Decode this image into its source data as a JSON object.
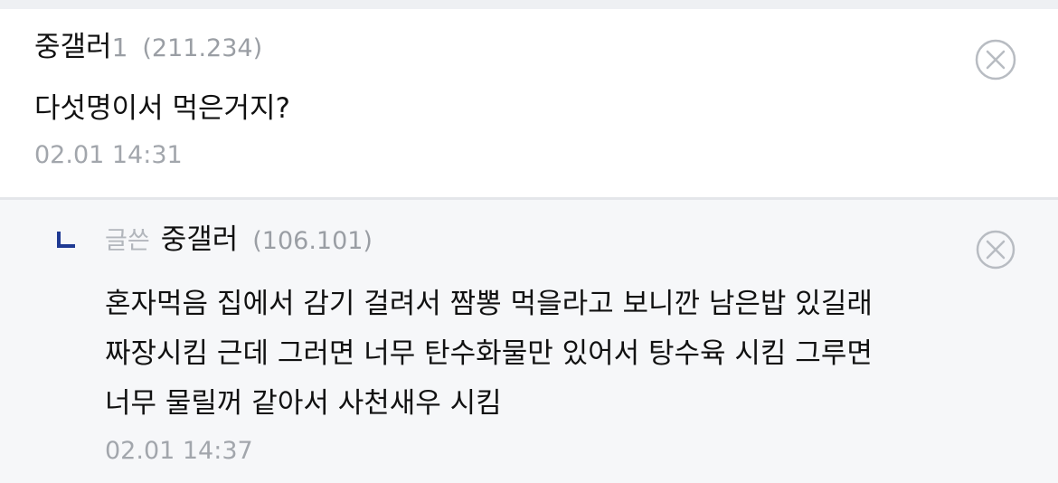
{
  "comment": {
    "nickname": "중갤러",
    "nickname_suffix": "1",
    "ip": "(211.234)",
    "text": "다섯명이서 먹은거지?",
    "time": "02.01 14:31",
    "delete_icon": "close-circle-icon"
  },
  "reply": {
    "arrow_icon": "reply-arrow-icon",
    "writer_tag": "글쓴",
    "nickname": "중갤러",
    "ip": "(106.101)",
    "text_lines": [
      "혼자먹음 집에서 감기 걸려서 짬뽕 먹을라고 보니깐 남은밥 있길래",
      "짜장시킴 근데 그러면 너무 탄수화물만 있어서 탕수육 시킴 그루면",
      "너무 물릴꺼 같아서 사천새우 시킴"
    ],
    "time": "02.01 14:37",
    "delete_icon": "close-circle-icon"
  },
  "colors": {
    "text": "#111111",
    "meta": "#9a9ea4",
    "reply_bg": "#f6f7f9",
    "icon": "#b8bcc2"
  }
}
